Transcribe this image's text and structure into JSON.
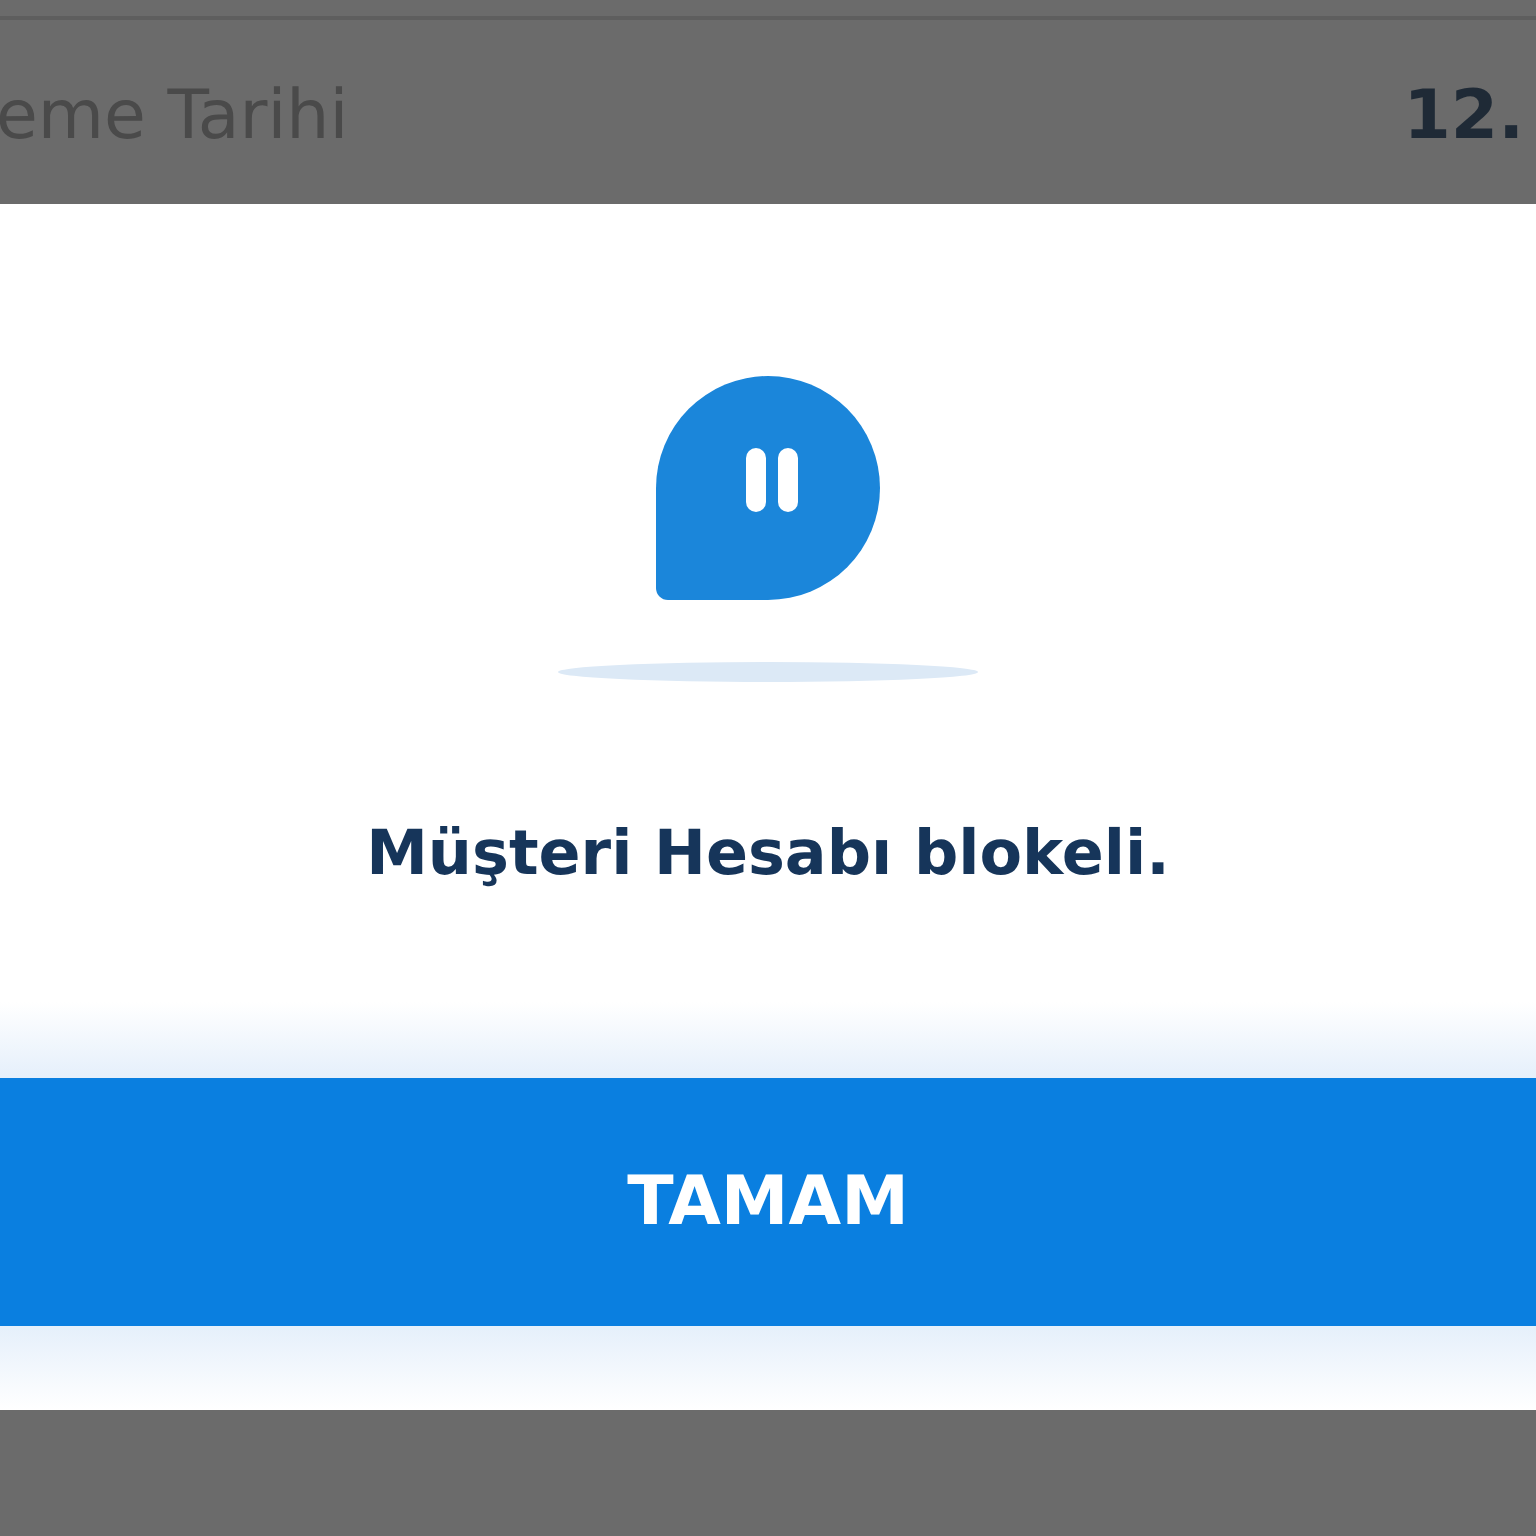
{
  "background_row": {
    "label": "eme Tarihi",
    "value": "12."
  },
  "dialog": {
    "message": "Müşteri Hesabı blokeli.",
    "button": "TAMAM"
  }
}
